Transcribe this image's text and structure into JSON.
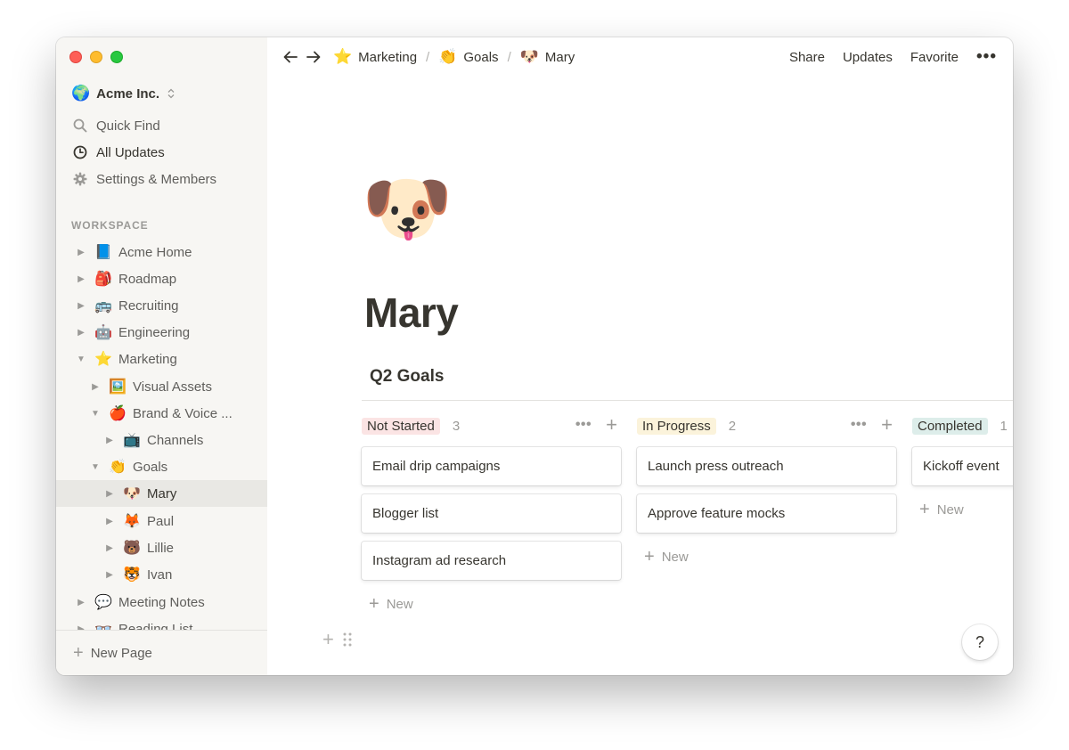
{
  "sidebar": {
    "workspace": {
      "emoji": "🌍",
      "name": "Acme Inc.",
      "chevron": "⌃⌄"
    },
    "nav": [
      {
        "label": "Quick Find",
        "icon": "search-icon"
      },
      {
        "label": "All Updates",
        "icon": "clock-icon"
      },
      {
        "label": "Settings & Members",
        "icon": "gear-icon"
      }
    ],
    "section_label": "WORKSPACE",
    "pages": [
      {
        "emoji": "📘",
        "label": "Acme Home",
        "expanded": false
      },
      {
        "emoji": "🎒",
        "label": "Roadmap",
        "expanded": false
      },
      {
        "emoji": "🚌",
        "label": "Recruiting",
        "expanded": false
      },
      {
        "emoji": "🤖",
        "label": "Engineering",
        "expanded": false
      },
      {
        "emoji": "⭐",
        "label": "Marketing",
        "expanded": true
      },
      {
        "emoji": "🖼️",
        "label": "Visual Assets",
        "expanded": false
      },
      {
        "emoji": "🍎",
        "label": "Brand & Voice ...",
        "expanded": true
      },
      {
        "emoji": "📺",
        "label": "Channels",
        "expanded": false
      },
      {
        "emoji": "👏",
        "label": "Goals",
        "expanded": true
      },
      {
        "emoji": "🐶",
        "label": "Mary",
        "expanded": false,
        "selected": true
      },
      {
        "emoji": "🦊",
        "label": "Paul",
        "expanded": false
      },
      {
        "emoji": "🐻",
        "label": "Lillie",
        "expanded": false
      },
      {
        "emoji": "🐯",
        "label": "Ivan",
        "expanded": false
      },
      {
        "emoji": "💬",
        "label": "Meeting Notes",
        "expanded": false
      },
      {
        "emoji": "👓",
        "label": "Reading List",
        "expanded": false
      }
    ],
    "new_page_label": "New Page"
  },
  "topbar": {
    "breadcrumb": [
      {
        "emoji": "⭐",
        "label": "Marketing"
      },
      {
        "emoji": "👏",
        "label": "Goals"
      },
      {
        "emoji": "🐶",
        "label": "Mary"
      }
    ],
    "separator": "/",
    "share_label": "Share",
    "updates_label": "Updates",
    "favorite_label": "Favorite",
    "more_label": "•••"
  },
  "page": {
    "icon": "🐶",
    "title": "Mary",
    "board_title": "Q2 Goals",
    "new_label": "New",
    "columns": [
      {
        "status": "Not Started",
        "count": "3",
        "color": "#fbe4e4",
        "cards": [
          "Email drip campaigns",
          "Blogger list",
          "Instagram ad research"
        ]
      },
      {
        "status": "In Progress",
        "count": "2",
        "color": "#fbf3db",
        "cards": [
          "Launch press outreach",
          "Approve feature mocks"
        ]
      },
      {
        "status": "Completed",
        "count": "1",
        "color": "#ddedea",
        "cards": [
          "Kickoff event"
        ]
      }
    ]
  },
  "help_label": "?"
}
